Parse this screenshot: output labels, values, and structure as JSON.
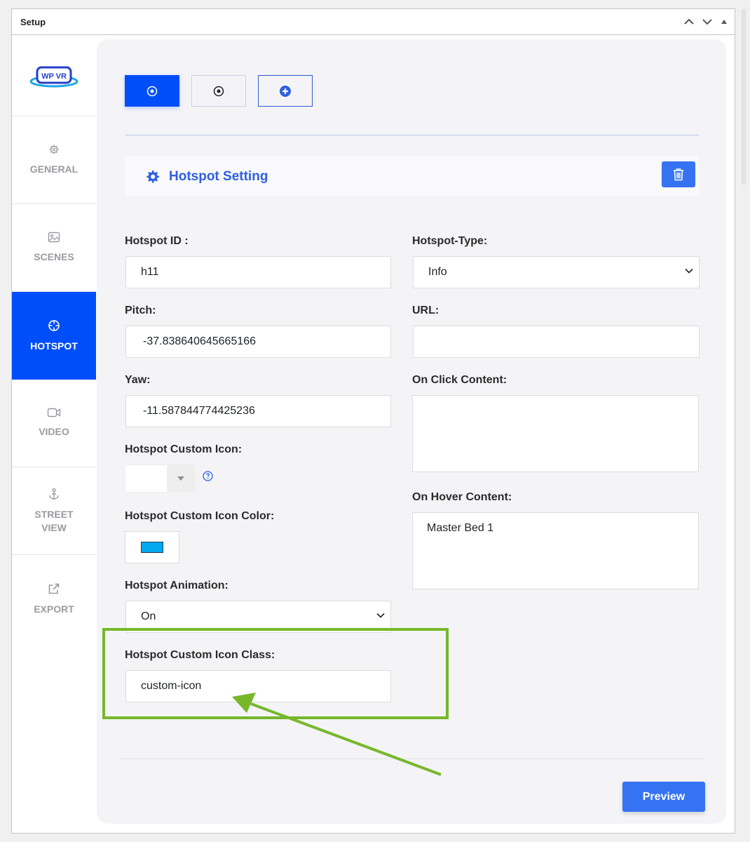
{
  "metabox": {
    "title": "Setup"
  },
  "logo": {
    "text": "WP VR"
  },
  "sidebar": {
    "items": [
      {
        "label": "GENERAL",
        "icon": "gear-icon"
      },
      {
        "label": "SCENES",
        "icon": "image-icon"
      },
      {
        "label": "HOTSPOT",
        "icon": "crosshair-icon",
        "active": true
      },
      {
        "label": "VIDEO",
        "icon": "video-icon"
      },
      {
        "label_line1": "STREET",
        "label_line2": "VIEW",
        "icon": "anchor-icon"
      },
      {
        "label": "EXPORT",
        "icon": "external-link-icon"
      }
    ]
  },
  "hotspot_section": {
    "title": "Hotspot Setting"
  },
  "form": {
    "hotspot_id": {
      "label": "Hotspot ID :",
      "value": "h11"
    },
    "hotspot_type": {
      "label": "Hotspot-Type:",
      "value": "Info"
    },
    "pitch": {
      "label": "Pitch:",
      "value": "-37.838640645665166"
    },
    "url": {
      "label": "URL:",
      "value": ""
    },
    "yaw": {
      "label": "Yaw:",
      "value": "-11.587844774425236"
    },
    "on_click": {
      "label": "On Click Content:",
      "value": ""
    },
    "custom_icon": {
      "label": "Hotspot Custom Icon:"
    },
    "on_hover": {
      "label": "On Hover Content:",
      "value": "Master Bed 1"
    },
    "custom_icon_color": {
      "label": "Hotspot Custom Icon Color:",
      "color": "#00a8ee"
    },
    "animation": {
      "label": "Hotspot Animation:",
      "value": "On"
    },
    "custom_icon_class": {
      "label": "Hotspot Custom Icon Class:",
      "value": "custom-icon"
    }
  },
  "actions": {
    "preview_label": "Preview"
  },
  "colors": {
    "accent": "#004efa",
    "button": "#3573f2",
    "highlight": "#76b82a"
  }
}
